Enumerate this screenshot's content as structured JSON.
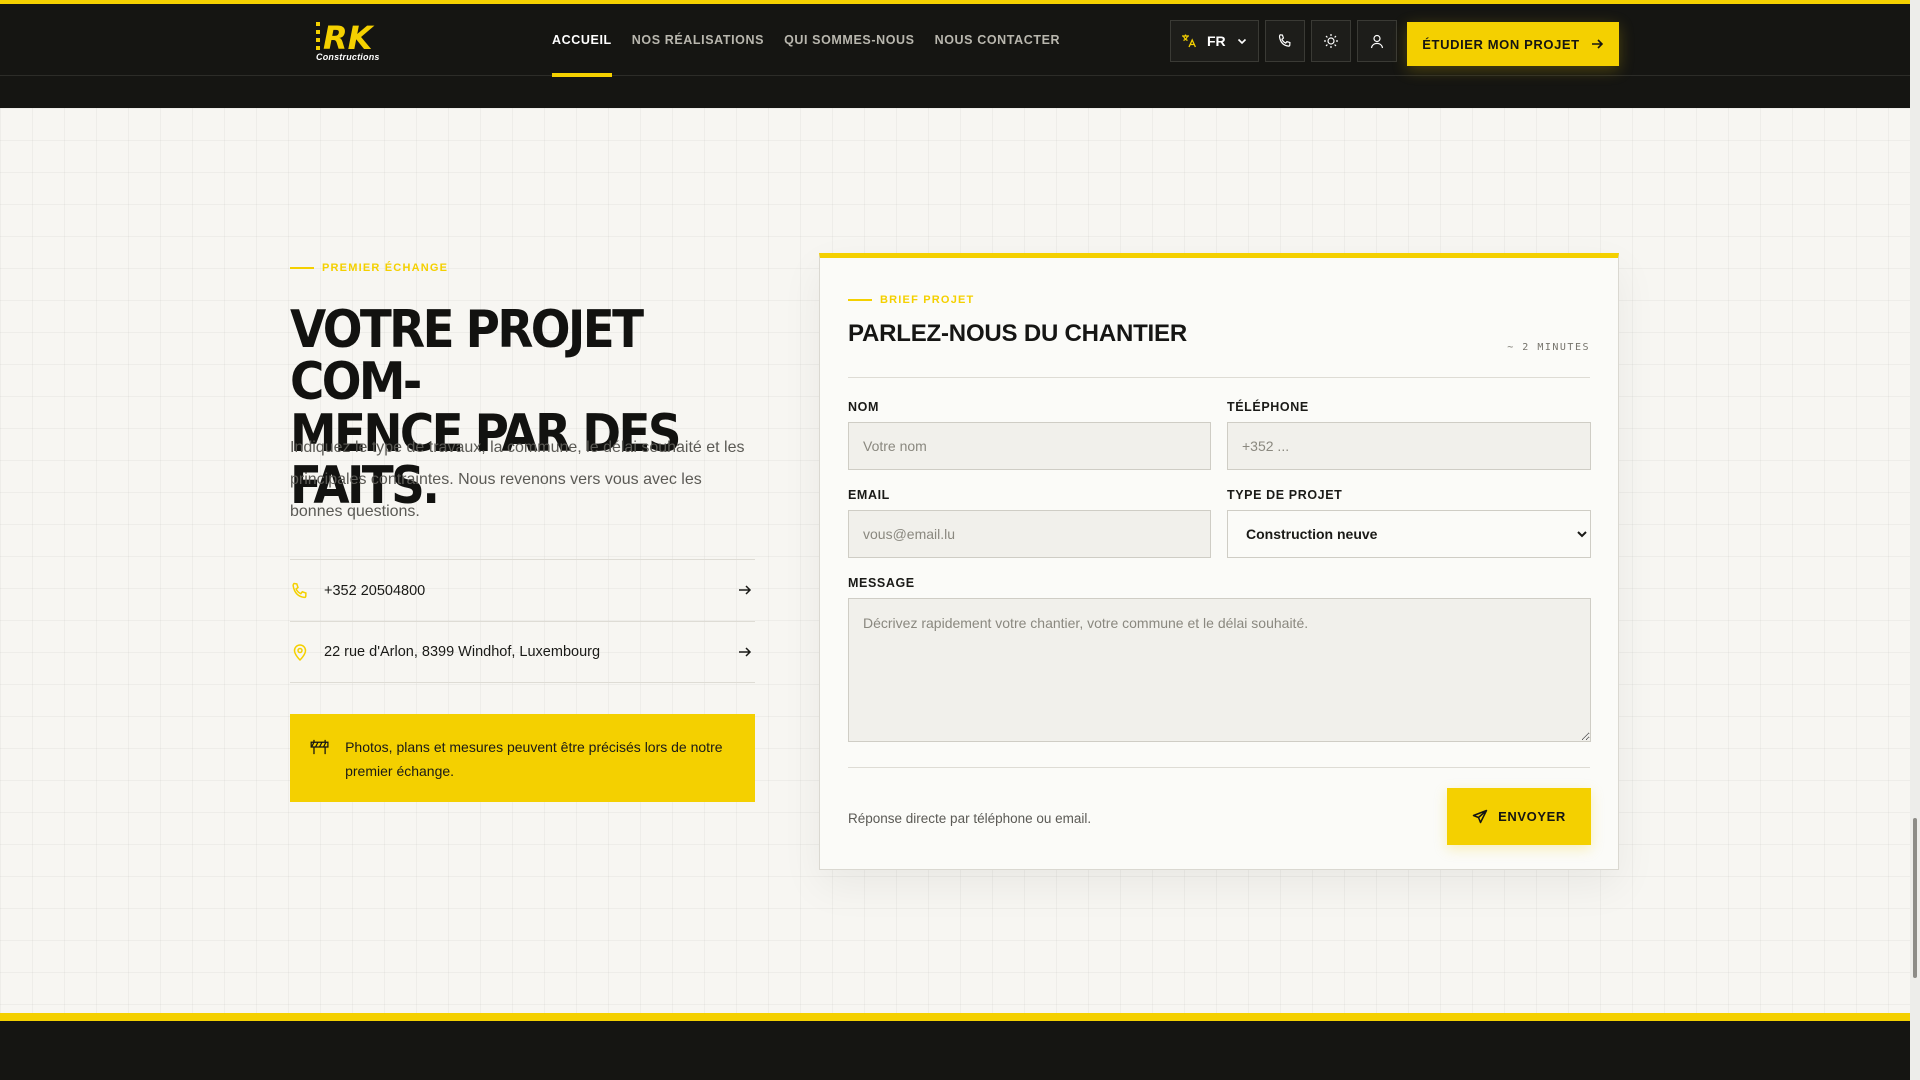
{
  "header": {
    "logo_text": "RK",
    "logo_sub": "Constructions",
    "nav": [
      {
        "label": "ACCUEIL",
        "active": true
      },
      {
        "label": "NOS RÉALISATIONS",
        "active": false
      },
      {
        "label": "QUI SOMMES-NOUS",
        "active": false
      },
      {
        "label": "NOUS CONTACTER",
        "active": false
      }
    ],
    "language": "FR",
    "cta_label": "ÉTUDIER MON PROJET",
    "icons": [
      "translate-icon",
      "chevron-down-icon",
      "phone-icon",
      "sun-icon",
      "user-icon",
      "arrow-right-icon"
    ]
  },
  "left": {
    "eyebrow": "PREMIER ÉCHANGE",
    "headline_line1": "VOTRE PROJET COM-",
    "headline_line2": "MENCE PAR DES FAITS.",
    "intro": "Indiquez le type de travaux, la commune, le délai souhaité et les principales contraintes. Nous revenons vers vous avec les bonnes questions.",
    "phone": "+352 20504800",
    "address": "22 rue d'Arlon, 8399 Windhof, Luxembourg",
    "notice": "Photos, plans et mesures peuvent être précisés lors de notre premier échange."
  },
  "form": {
    "eyebrow": "BRIEF PROJET",
    "title": "PARLEZ-NOUS DU CHANTIER",
    "time_hint": "~ 2 MINUTES",
    "name_label": "NOM",
    "name_placeholder": "Votre nom",
    "phone_label": "TÉLÉPHONE",
    "phone_placeholder": "+352 ...",
    "email_label": "EMAIL",
    "email_placeholder": "vous@email.lu",
    "type_label": "TYPE DE PROJET",
    "type_selected": "Construction neuve",
    "message_label": "MESSAGE",
    "message_placeholder": "Décrivez rapidement votre chantier, votre commune et le délai souhaité.",
    "footer_text": "Réponse directe par téléphone ou email.",
    "submit_label": "ENVOYER"
  },
  "colors": {
    "accent": "#f4d000",
    "dark": "#151512",
    "background": "#f7f6f2"
  }
}
